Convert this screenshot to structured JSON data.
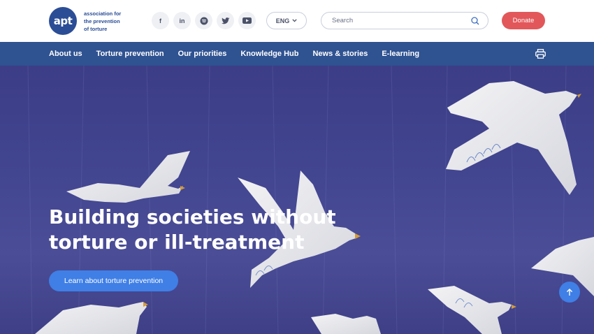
{
  "brand": {
    "logo_mark": "apt",
    "logo_lines": [
      "association for",
      "the prevention",
      "of torture"
    ]
  },
  "socials": [
    {
      "name": "facebook-icon",
      "glyph": "f"
    },
    {
      "name": "linkedin-icon",
      "glyph": "in"
    },
    {
      "name": "spotify-icon",
      "glyph": ""
    },
    {
      "name": "twitter-icon",
      "glyph": ""
    },
    {
      "name": "youtube-icon",
      "glyph": ""
    }
  ],
  "language": {
    "current": "ENG"
  },
  "search": {
    "placeholder": "Search"
  },
  "header": {
    "donate_label": "Donate"
  },
  "nav": {
    "items": [
      "About us",
      "Torture prevention",
      "Our priorities",
      "Knowledge Hub",
      "News & stories",
      "E-learning"
    ]
  },
  "hero": {
    "title_line1": "Building societies without",
    "title_line2": "torture or ill-treatment",
    "cta_label": "Learn about torture prevention"
  },
  "colors": {
    "brand_blue": "#2f5291",
    "donate_red": "#e2575a",
    "accent_blue": "#3f7fe6",
    "hero_purple": "#424590"
  }
}
